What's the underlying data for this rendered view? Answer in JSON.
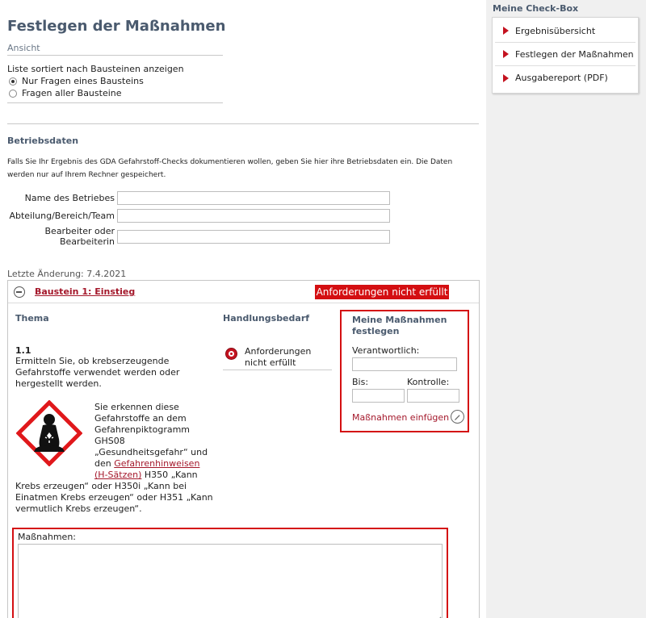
{
  "page": {
    "title": "Festlegen der Maßnahmen",
    "ansicht_label": "Ansicht",
    "list_label": "Liste sortiert nach Bausteinen anzeigen",
    "radio_options": [
      {
        "label": "Nur Fragen eines Bausteins",
        "selected": true
      },
      {
        "label": "Fragen aller Bausteine",
        "selected": false
      }
    ]
  },
  "betriebsdaten": {
    "title": "Betriebsdaten",
    "info": "Falls Sie Ihr Ergebnis des GDA Gefahrstoff-Checks dokumentieren wollen, geben Sie hier ihre Betriebsdaten ein. Die Daten werden nur auf Ihrem Rechner gespeichert.",
    "fields": [
      {
        "label": "Name des Betriebes",
        "value": ""
      },
      {
        "label": "Abteilung/Bereich/Team",
        "value": ""
      },
      {
        "label": "Bearbeiter oder Bearbeiterin",
        "value": ""
      }
    ],
    "last_change": "Letzte Änderung: 7.4.2021"
  },
  "baustein": {
    "title": "Baustein 1: Einstieg",
    "status": "Anforderungen nicht erfüllt",
    "status_color": "#d40f12",
    "col_thema": "Thema",
    "col_handlung": "Handlungsbedarf",
    "question_number": "1.1",
    "question_text": "Ermitteln Sie, ob krebserzeugende Gefahrstoffe verwendet werden oder hergestellt werden.",
    "hazard_icon": "ghs08-health-hazard-icon",
    "hazard_text_a": "Sie erkennen diese Gefahrstoffe an dem Gefahrenpiktogramm GHS08 „Gesundheitsgefahr“ und den",
    "hazard_link": "Gefahrenhinweisen (H-Sätzen)",
    "hazard_text_b": " H350 „Kann",
    "hazard_text_c": "Krebs erzeugen“ oder H350i „Kann bei Einatmen Krebs erzeugen“ oder H351 „Kann vermutlich Krebs erzeugen“.",
    "handlung_value": "Anforderungen nicht erfüllt",
    "massnahmen_box": {
      "title": "Meine Maßnahmen festlegen",
      "verantwortlich_label": "Verantwortlich:",
      "bis_label": "Bis:",
      "kontrolle_label": "Kontrolle:",
      "add_link": "Maßnahmen einfügen"
    },
    "massnahmen_label": "Maßnahmen:",
    "massnahmen_value": ""
  },
  "checkbox": {
    "title": "Meine Check-Box",
    "items": [
      {
        "label": "Ergebnisübersicht"
      },
      {
        "label": "Festlegen der Maßnahmen"
      },
      {
        "label": "Ausgabereport (PDF)"
      }
    ]
  }
}
